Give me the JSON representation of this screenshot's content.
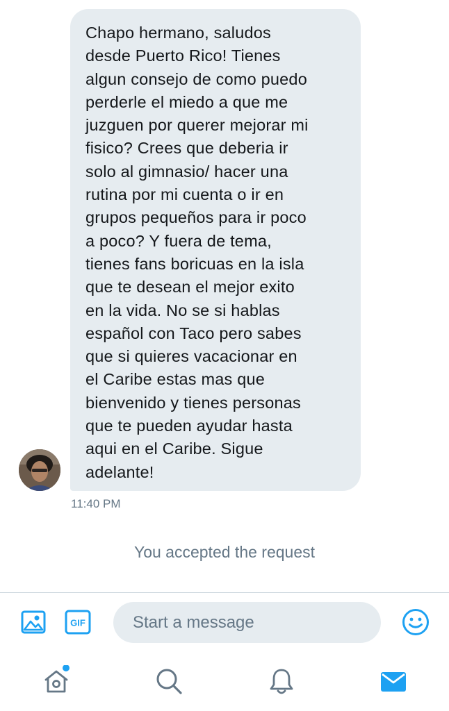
{
  "conversation": {
    "message_text": "Chapo hermano, saludos\ndesde Puerto Rico! Tienes\nalgun consejo de como puedo\nperderle el miedo a que me\njuzguen por querer mejorar mi\nfisico? Crees que deberia ir\nsolo al gimnasio/ hacer una\nrutina por mi cuenta o ir en\ngrupos pequeños para ir poco\na poco? Y fuera de tema,\ntienes fans boricuas en la isla\nque te desean el mejor exito\nen la vida. No se si hablas\nespañol con Taco pero sabes\nque si quieres vacacionar en\nel Caribe estas mas que\nbienvenido y tienes personas\nque te pueden ayudar hasta\naqui en el Caribe. Sigue\nadelante!",
    "timestamp": "11:40 PM",
    "system_message": "You accepted the request"
  },
  "composer": {
    "media_icon": "image-icon",
    "gif_label": "GIF",
    "placeholder": "Start a message",
    "emoji_icon": "emoji-smile-icon"
  },
  "bottom_nav": {
    "items": [
      {
        "icon": "home-icon",
        "has_notification_dot": true
      },
      {
        "icon": "search-icon"
      },
      {
        "icon": "notifications-bell-icon"
      },
      {
        "icon": "messages-envelope-icon",
        "active": true
      }
    ]
  },
  "colors": {
    "accent": "#1da1f2",
    "bubble_bg": "#e6ecf0",
    "secondary_text": "#657786",
    "primary_text": "#14171a",
    "nav_icon": "#657786"
  }
}
